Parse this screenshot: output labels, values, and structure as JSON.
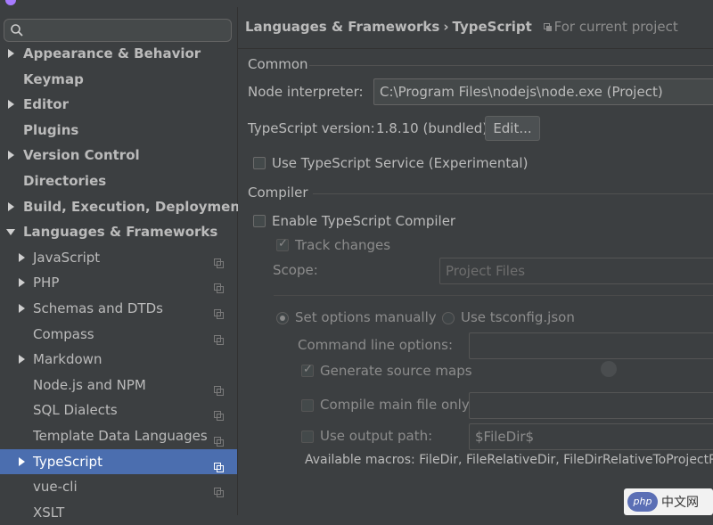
{
  "search": {
    "value": ""
  },
  "sidebar": {
    "items": [
      {
        "label": "Appearance & Behavior",
        "arrow": "right"
      },
      {
        "label": "Keymap",
        "arrow": ""
      },
      {
        "label": "Editor",
        "arrow": "right"
      },
      {
        "label": "Plugins",
        "arrow": ""
      },
      {
        "label": "Version Control",
        "arrow": "right"
      },
      {
        "label": "Directories",
        "arrow": ""
      },
      {
        "label": "Build, Execution, Deployment",
        "arrow": "right"
      },
      {
        "label": "Languages & Frameworks",
        "arrow": "down"
      },
      {
        "label": "JavaScript",
        "arrow": "right",
        "copy": true
      },
      {
        "label": "PHP",
        "arrow": "right",
        "copy": true
      },
      {
        "label": "Schemas and DTDs",
        "arrow": "right",
        "copy": true
      },
      {
        "label": "Compass",
        "arrow": "",
        "copy": true
      },
      {
        "label": "Markdown",
        "arrow": "right"
      },
      {
        "label": "Node.js and NPM",
        "arrow": "",
        "copy": true
      },
      {
        "label": "SQL Dialects",
        "arrow": "",
        "copy": true
      },
      {
        "label": "Template Data Languages",
        "arrow": "",
        "copy": true
      },
      {
        "label": "TypeScript",
        "arrow": "right",
        "copy": true,
        "selected": true
      },
      {
        "label": "vue-cli",
        "arrow": "",
        "copy": true
      },
      {
        "label": "XSLT",
        "arrow": ""
      }
    ]
  },
  "breadcrumb": {
    "parent": "Languages & Frameworks",
    "separator": "›",
    "current": "TypeScript",
    "scope": "For current project"
  },
  "common": {
    "title": "Common",
    "node_interpreter_label": "Node interpreter:",
    "node_interpreter_value": "C:\\Program Files\\nodejs\\node.exe  (Project)",
    "ts_version_label": "TypeScript version:",
    "ts_version_value": "1.8.10 (bundled)",
    "edit_button": "Edit...",
    "use_service_label": "Use TypeScript Service (Experimental)",
    "use_service_checked": false
  },
  "compiler": {
    "title": "Compiler",
    "enable_label": "Enable TypeScript Compiler",
    "enable_checked": false,
    "track_changes_label": "Track changes",
    "track_changes_checked": true,
    "scope_label": "Scope:",
    "scope_value": "Project Files",
    "set_manually_label": "Set options manually",
    "use_tsconfig_label": "Use tsconfig.json",
    "selected_mode": "manual",
    "cmdline_label": "Command line options:",
    "cmdline_value": "",
    "source_maps_label": "Generate source maps",
    "source_maps_checked": true,
    "compile_main_label": "Compile main file only:",
    "compile_main_checked": false,
    "compile_main_value": "",
    "output_path_label": "Use output path:",
    "output_path_checked": false,
    "output_path_value": "$FileDir$",
    "macros_text": "Available macros: FileDir, FileRelativeDir, FileDirRelativeToProjectRoo"
  },
  "watermark": {
    "badge": "php",
    "text": "中文网"
  },
  "colors": {
    "selection": "#4b6eaf",
    "background": "#3c3f41",
    "text": "#bbbbbb"
  }
}
